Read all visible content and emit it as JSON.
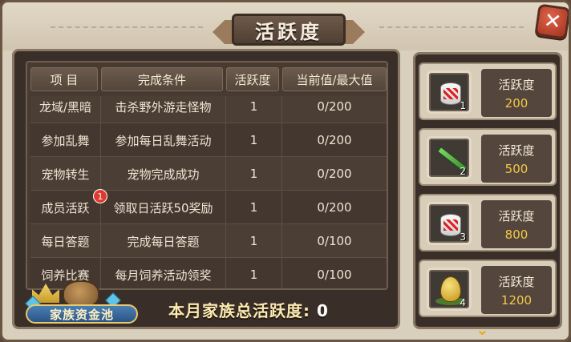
{
  "window": {
    "title": "活跃度"
  },
  "table": {
    "headers": [
      "项 目",
      "完成条件",
      "活跃度",
      "当前值/最大值"
    ],
    "rows": [
      {
        "item": "龙域/黑暗",
        "condition": "击杀野外游走怪物",
        "activity": "1",
        "progress": "0/200"
      },
      {
        "item": "参加乱舞",
        "condition": "参加每日乱舞活动",
        "activity": "1",
        "progress": "0/200"
      },
      {
        "item": "宠物转生",
        "condition": "宠物完成成功",
        "activity": "1",
        "progress": "0/200"
      },
      {
        "item": "成员活跃",
        "condition": "领取日活跃50奖励",
        "activity": "1",
        "progress": "0/200",
        "badge": "1"
      },
      {
        "item": "每日答题",
        "condition": "完成每日答题",
        "activity": "1",
        "progress": "0/100"
      },
      {
        "item": "饲养比赛",
        "condition": "每月饲养活动领奖",
        "activity": "1",
        "progress": "0/100"
      }
    ]
  },
  "fund": {
    "label": "家族资金池"
  },
  "total": {
    "label": "本月家族总活跃度:",
    "value": "0"
  },
  "rewards": [
    {
      "label": "活跃度",
      "value": "200",
      "count": "1",
      "icon": "drum-icon"
    },
    {
      "label": "活跃度",
      "value": "500",
      "count": "2",
      "icon": "sword-icon"
    },
    {
      "label": "活跃度",
      "value": "800",
      "count": "3",
      "icon": "drum-icon"
    },
    {
      "label": "活跃度",
      "value": "1200",
      "count": "4",
      "icon": "egg-icon"
    }
  ],
  "colors": {
    "accent": "#f0c84a",
    "badge": "#e03a2e",
    "close": "#c0412b"
  }
}
